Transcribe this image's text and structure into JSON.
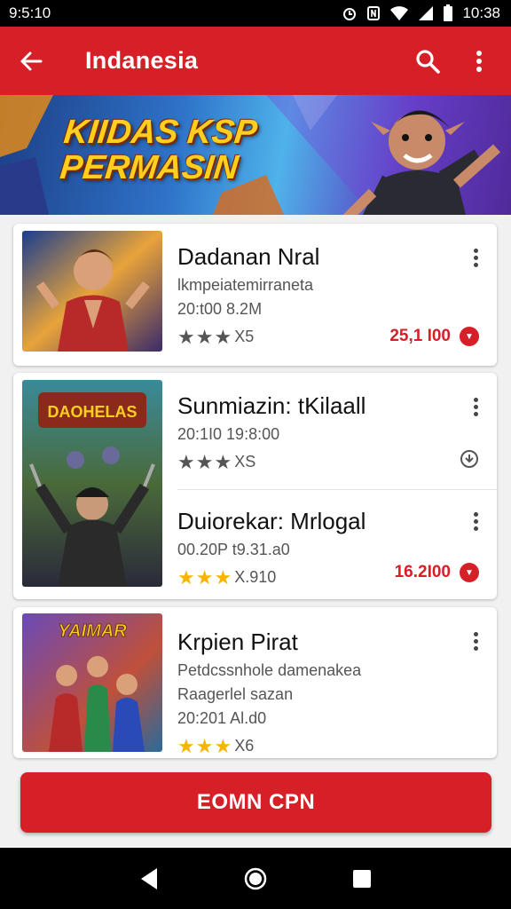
{
  "status_bar": {
    "time": "9:5:10",
    "clock": "10:38",
    "icons": [
      "alarm-icon",
      "nfc-icon",
      "wifi-icon",
      "signal-icon",
      "battery-icon"
    ]
  },
  "app_bar": {
    "title": "Indanesia",
    "back_icon": "arrow-left-icon",
    "search_icon": "search-icon",
    "menu_icon": "more-vert-icon"
  },
  "banner": {
    "headline_line1": "KIIDAS KSP",
    "headline_line2": "PERMASIN"
  },
  "cards": [
    {
      "items": [
        {
          "name": "Dadanan Nral",
          "subtitle": "lkmpeiatemirraneta",
          "meta": "20:t00 8.2M",
          "rating_text": "X5",
          "price": "25,1 I00"
        }
      ]
    },
    {
      "items": [
        {
          "name": "Sunmiazin: tKilaall",
          "meta": "20:1I0 19:8:00",
          "rating_text": "XS"
        },
        {
          "name": "Duiorekar: Mrlogal",
          "meta": "00.20P t9.31.a0",
          "rating_text": "X.910",
          "price": "16.2I00"
        }
      ]
    },
    {
      "items": [
        {
          "name": "Krpien Pirat",
          "subtitle": "Petdcssnhole damenakea",
          "subtitle2": "Raagerlel sazan",
          "meta": "20:201 Al.d0",
          "rating_text": "X6"
        }
      ]
    }
  ],
  "thumb_labels": {
    "card2": "DAOHELAS",
    "card3": "YAIMAR"
  },
  "cta": {
    "label": "EOMN CPN"
  },
  "colors": {
    "accent": "#d61f26",
    "star_gold": "#f7b500",
    "star_gray": "#555555"
  }
}
